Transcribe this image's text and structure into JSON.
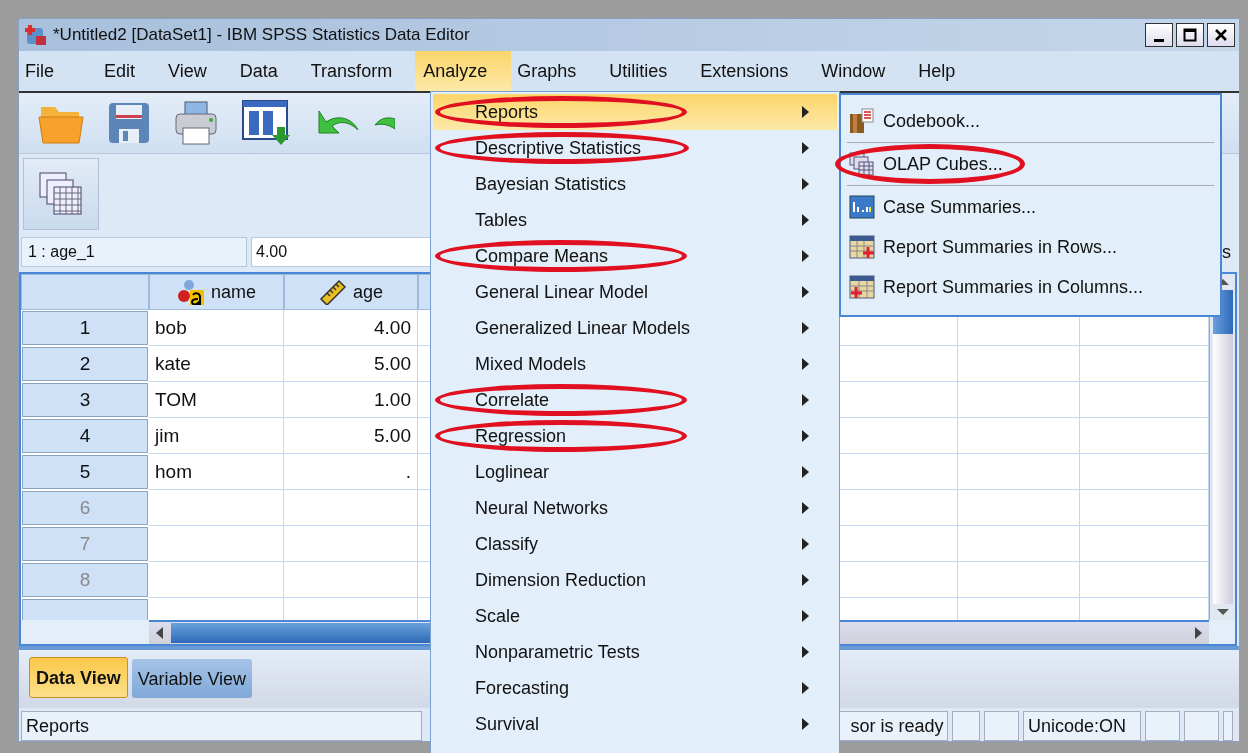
{
  "window": {
    "title": "*Untitled2 [DataSet1] - IBM SPSS Statistics Data Editor"
  },
  "menu_bar": [
    {
      "label": "File",
      "selected": false
    },
    {
      "label": "Edit",
      "selected": false
    },
    {
      "label": "View",
      "selected": false
    },
    {
      "label": "Data",
      "selected": false
    },
    {
      "label": "Transform",
      "selected": false
    },
    {
      "label": "Analyze",
      "selected": true
    },
    {
      "label": "Graphs",
      "selected": false
    },
    {
      "label": "Utilities",
      "selected": false
    },
    {
      "label": "Extensions",
      "selected": false
    },
    {
      "label": "Window",
      "selected": false
    },
    {
      "label": "Help",
      "selected": false
    }
  ],
  "cell_editor": {
    "cell": "1 : age_1",
    "value": "4.00",
    "right_text": "s"
  },
  "grid": {
    "columns": [
      {
        "name": "name",
        "kind": "string"
      },
      {
        "name": "age",
        "kind": "scale"
      }
    ],
    "rows": [
      {
        "number": "1",
        "filled": true,
        "cells": [
          "bob",
          "4.00"
        ]
      },
      {
        "number": "2",
        "filled": true,
        "cells": [
          "kate",
          "5.00"
        ]
      },
      {
        "number": "3",
        "filled": true,
        "cells": [
          "TOM",
          "1.00"
        ]
      },
      {
        "number": "4",
        "filled": true,
        "cells": [
          "jim",
          "5.00"
        ]
      },
      {
        "number": "5",
        "filled": true,
        "cells": [
          "hom",
          "."
        ]
      },
      {
        "number": "6",
        "filled": false
      },
      {
        "number": "7",
        "filled": false
      },
      {
        "number": "8",
        "filled": false
      }
    ]
  },
  "view_tabs": [
    {
      "label": "Data View",
      "selected": true
    },
    {
      "label": "Variable View",
      "selected": false
    }
  ],
  "status_bar": {
    "message": "Reports",
    "processor": "sor is ready",
    "unicode": "Unicode:ON"
  },
  "analyze_menu": [
    {
      "label": "Reports",
      "selected": true,
      "circled": true
    },
    {
      "label": "Descriptive Statistics",
      "selected": false,
      "circled": true
    },
    {
      "label": "Bayesian Statistics",
      "selected": false,
      "circled": false
    },
    {
      "label": "Tables",
      "selected": false,
      "circled": false
    },
    {
      "label": "Compare Means",
      "selected": false,
      "circled": true
    },
    {
      "label": "General Linear Model",
      "selected": false,
      "circled": false
    },
    {
      "label": "Generalized Linear Models",
      "selected": false,
      "circled": false
    },
    {
      "label": "Mixed Models",
      "selected": false,
      "circled": false
    },
    {
      "label": "Correlate",
      "selected": false,
      "circled": true
    },
    {
      "label": "Regression",
      "selected": false,
      "circled": true
    },
    {
      "label": "Loglinear",
      "selected": false,
      "circled": false
    },
    {
      "label": "Neural Networks",
      "selected": false,
      "circled": false
    },
    {
      "label": "Classify",
      "selected": false,
      "circled": false
    },
    {
      "label": "Dimension Reduction",
      "selected": false,
      "circled": false
    },
    {
      "label": "Scale",
      "selected": false,
      "circled": false
    },
    {
      "label": "Nonparametric Tests",
      "selected": false,
      "circled": false
    },
    {
      "label": "Forecasting",
      "selected": false,
      "circled": false
    },
    {
      "label": "Survival",
      "selected": false,
      "circled": false
    }
  ],
  "reports_submenu": [
    {
      "label": "Codebook...",
      "kind": "codebook",
      "circled": false,
      "separator_after": true
    },
    {
      "label": "OLAP Cubes...",
      "kind": "cubes",
      "circled": true,
      "separator_after": true
    },
    {
      "label": "Case Summaries...",
      "kind": "cases",
      "circled": false,
      "separator_after": false
    },
    {
      "label": "Report Summaries in Rows...",
      "kind": "rows",
      "circled": false,
      "separator_after": false
    },
    {
      "label": "Report Summaries in Columns...",
      "kind": "columns",
      "circled": false,
      "separator_after": false
    }
  ]
}
